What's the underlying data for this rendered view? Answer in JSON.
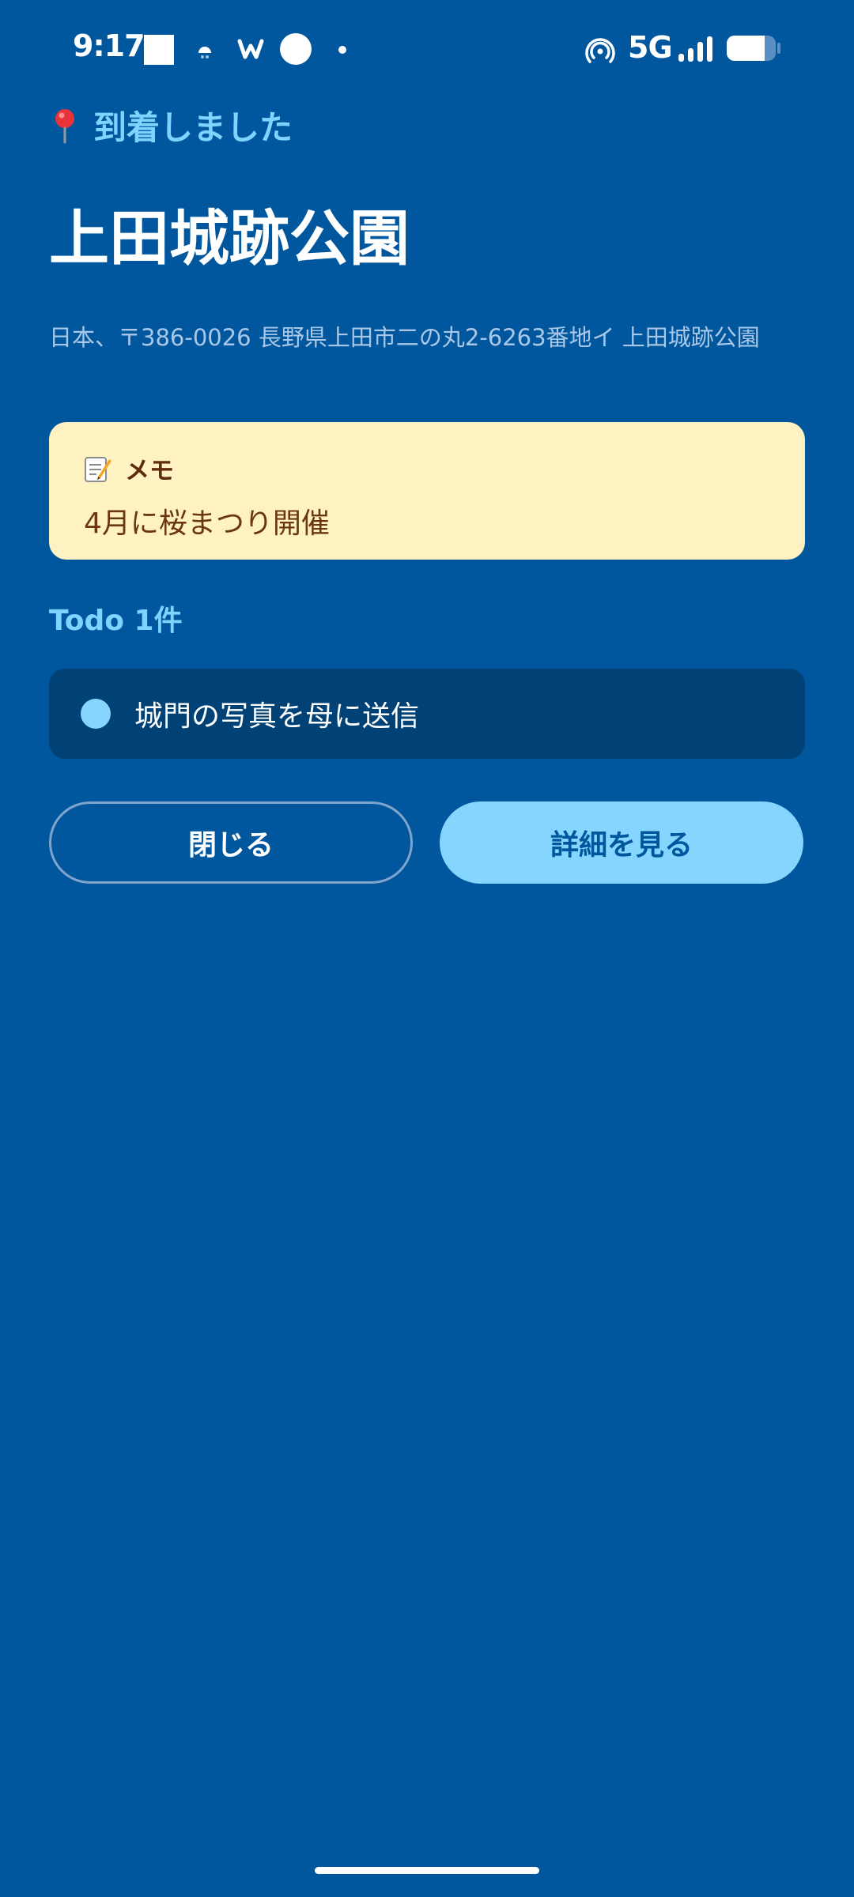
{
  "status_bar": {
    "time": "9:17",
    "network": "5G",
    "icons": [
      "square-icon",
      "weather-icon",
      "w-app-icon",
      "circle-icon",
      "dot-icon",
      "hotspot-icon",
      "signal-icon",
      "battery-icon"
    ]
  },
  "arrival": {
    "label": "到着しました",
    "icon": "pin-icon"
  },
  "place": {
    "title": "上田城跡公園",
    "address": "日本、〒386-0026 長野県上田市二の丸2-6263番地イ 上田城跡公園"
  },
  "memo": {
    "icon": "memo-icon",
    "label": "メモ",
    "text": "4月に桜まつり開催"
  },
  "todo": {
    "heading": "Todo 1件",
    "items": [
      {
        "text": "城門の写真を母に送信"
      }
    ]
  },
  "actions": {
    "close_label": "閉じる",
    "detail_label": "詳細を見る"
  },
  "colors": {
    "background": "#00579E",
    "accent": "#85D5FF",
    "memo_background": "#FFF2C2",
    "todo_background": "#004276"
  }
}
